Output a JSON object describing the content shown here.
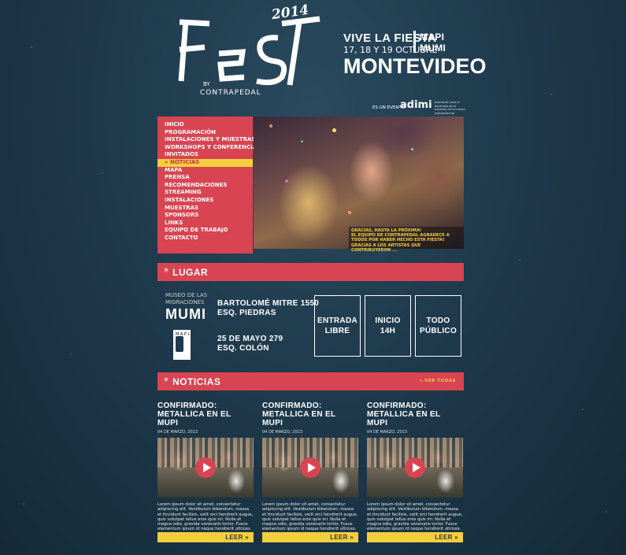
{
  "header": {
    "logo_year": "2014",
    "logo_by": "BY",
    "logo_brand": "CONTRAPEDAL",
    "tagline": "VIVE LA FIESTA",
    "dates": "17, 18 Y 19 OCTUBRE",
    "city": "MONTEVIDEO",
    "venue_short_1": "MAPI",
    "venue_short_2": "MUMI",
    "event_text": "ES UN EVENTO",
    "partner_logo": "adimi",
    "partner_desc": "asociación para el desarrollo de la industria de la música independiente"
  },
  "nav": {
    "items": [
      {
        "label": "Inicio"
      },
      {
        "label": "Programación"
      },
      {
        "label": "Instalaciones y muestras"
      },
      {
        "label": "Workshops y conferencias"
      },
      {
        "label": "Invitados"
      },
      {
        "label": "» Noticias"
      },
      {
        "label": "Mapa"
      },
      {
        "label": "Prensa"
      },
      {
        "label": "Recomendaciones"
      },
      {
        "label": "Streaming"
      },
      {
        "label": "Instalaciones"
      },
      {
        "label": "Muestras"
      },
      {
        "label": "Sponsors"
      },
      {
        "label": "Links"
      },
      {
        "label": "Equipo de trabajo"
      },
      {
        "label": "Contacto"
      }
    ]
  },
  "hero": {
    "caption_line1": "Gracias, hasta la próxima!",
    "caption_line2": "El equipo de Contrapedal agradece a todos por haber hecho esta fiesta! Gracias a los artistas que contribuyeron ..."
  },
  "lugar": {
    "title": "LUGAR",
    "museo_label": "MUSEO DE LAS MIGRACIONES",
    "mumi": "MUMI",
    "addr1_line1": "BARTOLOMÉ MITRE 1550",
    "addr1_line2": "ESQ. PIEDRAS",
    "mapi_letters": "M A P I",
    "addr2_line1": "25 DE MAYO 279",
    "addr2_line2": "ESQ. COLÓN",
    "box1_l1": "ENTRADA",
    "box1_l2": "LIBRE",
    "box2_l1": "INICIO",
    "box2_l2": "14H",
    "box3_l1": "TODO",
    "box3_l2": "PÚBLICO"
  },
  "noticias": {
    "title": "NOTICIAS",
    "ver_todas": "» VER TODAS",
    "items": [
      {
        "title1": "CONFIRMADO:",
        "title2": "METALLICA EN EL MUPI",
        "date": "04 DE MARZO, 2013",
        "body": "Lorem ipsum dolor sit amet, consectetur adipiscing elit. Vestibulum bibendum, massa et tincidunt facilisis, velit orci hendrerit augue, quis volutpat tellus eros quis mi. Nulla et magna odio, gravida venenatis tortor. Fusce elementum ipsum id neque hendrerit ultrices. Vivamus id luctus velit.",
        "leer": "LEER »"
      },
      {
        "title1": "CONFIRMADO:",
        "title2": "METALLICA EN EL MUPI",
        "date": "04 DE MARZO, 2013",
        "body": "Lorem ipsum dolor sit amet, consectetur adipiscing elit. Vestibulum bibendum, massa et tincidunt facilisis, velit orci hendrerit augue, quis volutpat tellus eros quis mi. Nulla et magna odio, gravida venenatis tortor. Fusce elementum ipsum id neque hendrerit ultrices. Vivamus id luctus velit.",
        "leer": "LEER »"
      },
      {
        "title1": "CONFIRMADO:",
        "title2": "METALLICA EN EL MUPI",
        "date": "04 DE MARZO, 2013",
        "body": "Lorem ipsum dolor sit amet, consectetur adipiscing elit. Vestibulum bibendum, massa et tincidunt facilisis, velit orci hendrerit augue, quis volutpat tellus eros quis mi. Nulla et magna odio, gravida venenatis tortor. Fusce elementum ipsum id neque hendrerit ultrices. Vivamus id luctus velit.",
        "leer": "LEER »"
      }
    ]
  },
  "colors": {
    "accent_red": "#d94452",
    "accent_yellow": "#f3cf3e",
    "background": "#1f3a4d"
  }
}
